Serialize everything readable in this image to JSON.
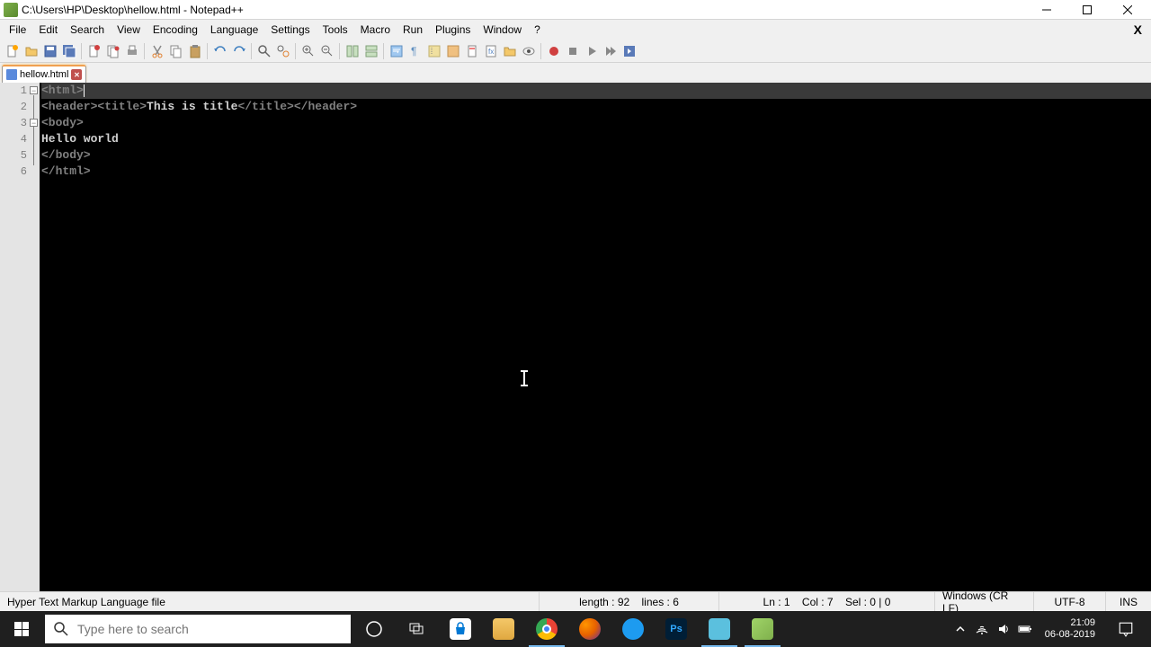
{
  "window": {
    "title": "C:\\Users\\HP\\Desktop\\hellow.html - Notepad++"
  },
  "menubar": [
    "File",
    "Edit",
    "Search",
    "View",
    "Encoding",
    "Language",
    "Settings",
    "Tools",
    "Macro",
    "Run",
    "Plugins",
    "Window",
    "?"
  ],
  "tab": {
    "label": "hellow.html"
  },
  "code": {
    "lines": [
      {
        "num": "1",
        "segments": [
          {
            "t": "tag",
            "v": "<html>"
          }
        ],
        "active": true,
        "fold": "minus"
      },
      {
        "num": "2",
        "segments": [
          {
            "t": "tag",
            "v": "<header><title>"
          },
          {
            "t": "text",
            "v": "This is title"
          },
          {
            "t": "tag",
            "v": "</title></header>"
          }
        ]
      },
      {
        "num": "3",
        "segments": [
          {
            "t": "tag",
            "v": "<body>"
          }
        ],
        "fold": "minus"
      },
      {
        "num": "4",
        "segments": [
          {
            "t": "text",
            "v": "Hello world"
          }
        ]
      },
      {
        "num": "5",
        "segments": [
          {
            "t": "tag",
            "v": "</body>"
          }
        ]
      },
      {
        "num": "6",
        "segments": [
          {
            "t": "tag",
            "v": "</html>"
          }
        ]
      }
    ]
  },
  "statusbar": {
    "filetype": "Hyper Text Markup Language file",
    "length": "length : 92",
    "lines": "lines : 6",
    "ln": "Ln : 1",
    "col": "Col : 7",
    "sel": "Sel : 0 | 0",
    "eol": "Windows (CR LF)",
    "encoding": "UTF-8",
    "mode": "INS"
  },
  "taskbar": {
    "search_placeholder": "Type here to search",
    "clock_time": "21:09",
    "clock_date": "06-08-2019"
  }
}
